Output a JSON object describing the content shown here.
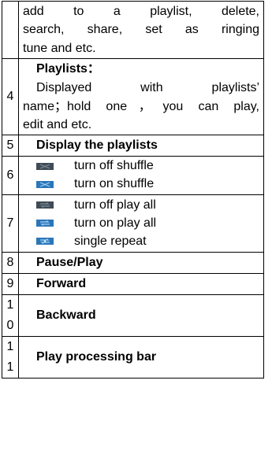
{
  "rows": {
    "r3": {
      "num": "",
      "lines": [
        "add to a playlist, delete,",
        "search, share, set as ringing",
        "tune and etc."
      ]
    },
    "r4": {
      "num": "4",
      "title": "Playlists：",
      "lines": [
        "Displayed with playlists’",
        "name；hold one，you can play,",
        "edit and etc."
      ]
    },
    "r5": {
      "num": "5",
      "label": "Display the playlists"
    },
    "r6": {
      "num": "6",
      "items": [
        {
          "icon": "shuffle-off-icon",
          "label": "turn off shuffle"
        },
        {
          "icon": "shuffle-on-icon",
          "label": "turn on shuffle"
        }
      ]
    },
    "r7": {
      "num": "7",
      "items": [
        {
          "icon": "play-all-off-icon",
          "label": "turn off play all"
        },
        {
          "icon": "play-all-on-icon",
          "label": "turn on play all"
        },
        {
          "icon": "single-repeat-icon",
          "label": "single repeat"
        }
      ]
    },
    "r8": {
      "num": "8",
      "label": "Pause/Play"
    },
    "r9": {
      "num": "9",
      "label": "Forward"
    },
    "r10": {
      "num_top": "1",
      "num_bottom": "0",
      "label": "Backward"
    },
    "r11": {
      "num_top": "1",
      "num_bottom": "1",
      "label": "Play processing bar"
    }
  },
  "colors": {
    "icon_off": "#3f4b56",
    "icon_on": "#2c76b8"
  }
}
